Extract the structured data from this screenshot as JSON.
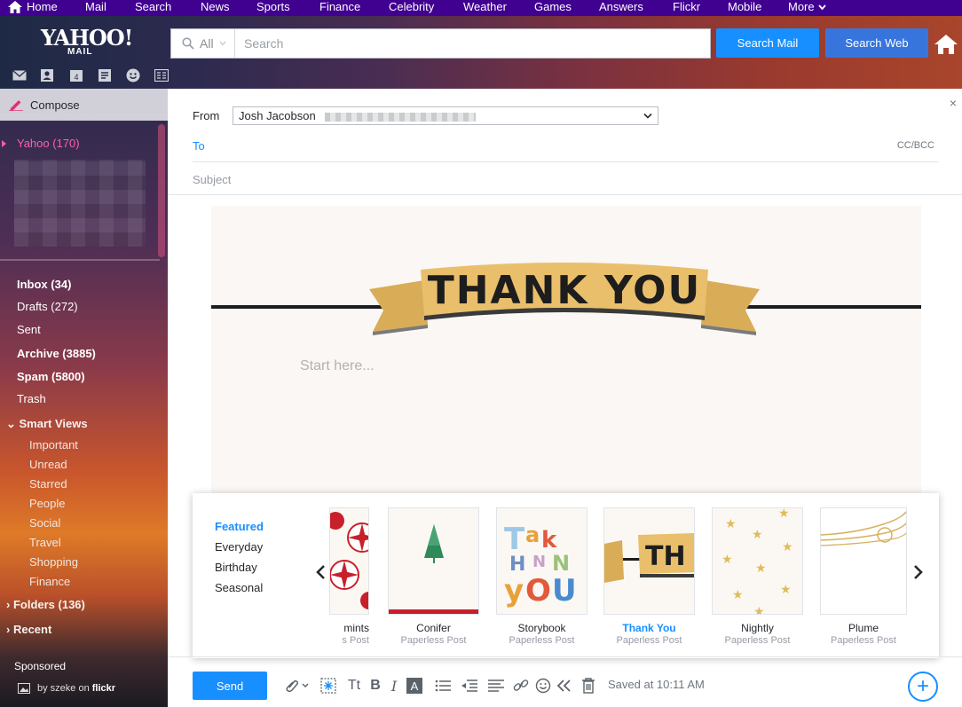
{
  "topnav": {
    "items": [
      "Home",
      "Mail",
      "Search",
      "News",
      "Sports",
      "Finance",
      "Celebrity",
      "Weather",
      "Games",
      "Answers",
      "Flickr",
      "Mobile",
      "More"
    ]
  },
  "header": {
    "logo": "YAHOO!",
    "logo_sub": "MAIL",
    "search_scope": "All",
    "search_placeholder": "Search",
    "search_mail_label": "Search Mail",
    "search_web_label": "Search Web"
  },
  "sidebar": {
    "compose_label": "Compose",
    "account": "Yahoo  (170)",
    "folders": [
      "Inbox (34)",
      "Drafts (272)",
      "Sent",
      "Archive (3885)",
      "Spam (5800)",
      "Trash"
    ],
    "smart_views_label": "Smart Views",
    "smart_views": [
      "Important",
      "Unread",
      "Starred",
      "People",
      "Social",
      "Travel",
      "Shopping",
      "Finance"
    ],
    "folders_section": "Folders (136)",
    "recent_section": "Recent",
    "sponsored": "Sponsored",
    "photo_credit_prefix": "by szeke on",
    "photo_credit_site": "flickr"
  },
  "compose": {
    "from_label": "From",
    "from_name": "Josh Jacobson",
    "to_label": "To",
    "ccbcc_label": "CC/BCC",
    "subject_placeholder": "Subject",
    "body_placeholder": "Start here...",
    "banner_text": "THANK YOU",
    "close": "×"
  },
  "stationery": {
    "categories": [
      "Featured",
      "Everyday",
      "Birthday",
      "Seasonal"
    ],
    "active_category": "Featured",
    "cards": [
      {
        "name": "mints",
        "source": "s Post"
      },
      {
        "name": "Conifer",
        "source": "Paperless Post"
      },
      {
        "name": "Storybook",
        "source": "Paperless Post"
      },
      {
        "name": "Thank You",
        "source": "Paperless Post"
      },
      {
        "name": "Nightly",
        "source": "Paperless Post"
      },
      {
        "name": "Plume",
        "source": "Paperless Post"
      }
    ]
  },
  "toolbar": {
    "send_label": "Send",
    "saved_text": "Saved at 10:11 AM",
    "plus": "+"
  },
  "colors": {
    "accent": "#188fff",
    "nav_purple": "#400090",
    "account_pink": "#ff5fa6",
    "banner_gold": "#e9bf6b"
  }
}
